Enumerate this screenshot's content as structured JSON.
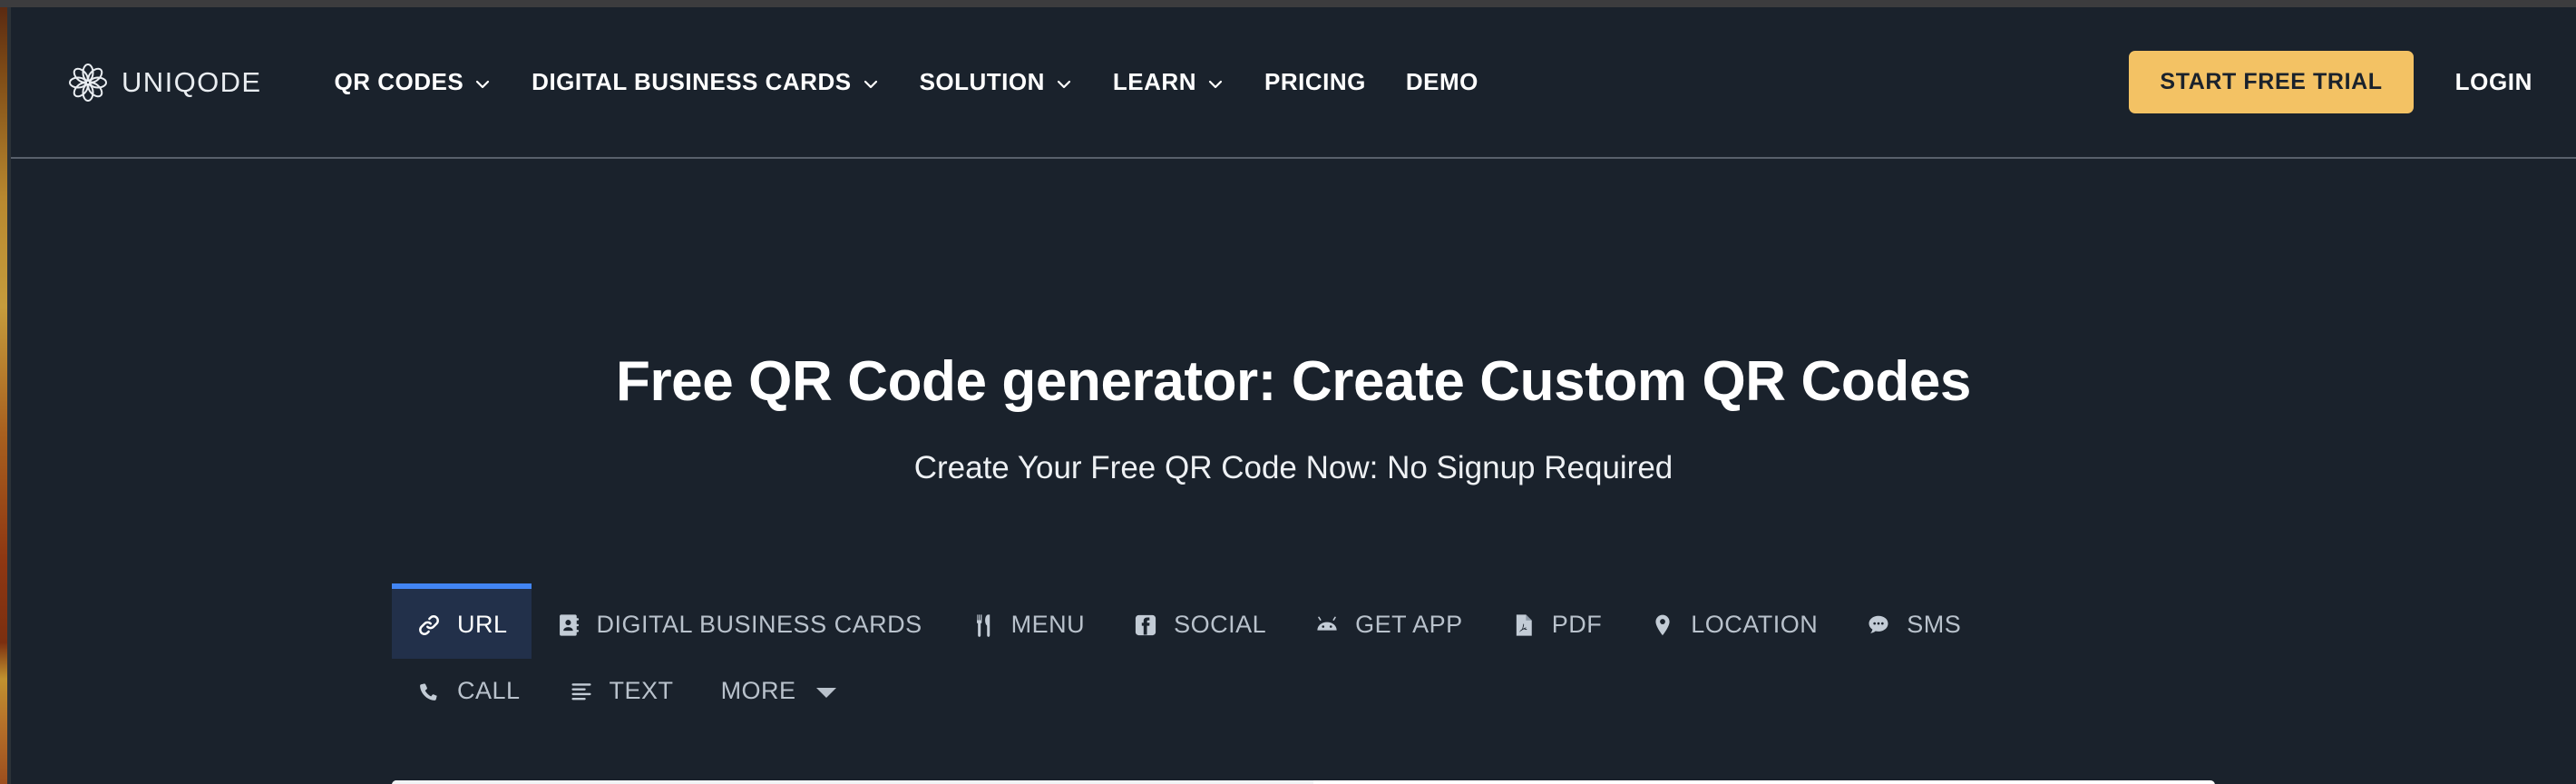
{
  "brand": {
    "name": "UNIQODE",
    "logo_icon": "flower-rosette-logo-icon"
  },
  "nav": {
    "items": [
      {
        "label": "QR CODES",
        "has_dropdown": true
      },
      {
        "label": "DIGITAL BUSINESS CARDS",
        "has_dropdown": true
      },
      {
        "label": "SOLUTION",
        "has_dropdown": true
      },
      {
        "label": "LEARN",
        "has_dropdown": true
      },
      {
        "label": "PRICING",
        "has_dropdown": false
      },
      {
        "label": "DEMO",
        "has_dropdown": false
      }
    ]
  },
  "header_actions": {
    "cta_label": "START FREE TRIAL",
    "login_label": "LOGIN"
  },
  "hero": {
    "title": "Free QR Code generator: Create Custom QR Codes",
    "subtitle": "Create Your Free QR Code Now: No Signup Required"
  },
  "tabs": {
    "active": "URL",
    "row1": [
      {
        "label": "URL",
        "icon": "link-icon",
        "active": true
      },
      {
        "label": "DIGITAL BUSINESS CARDS",
        "icon": "contact-card-icon",
        "active": false
      },
      {
        "label": "MENU",
        "icon": "fork-knife-icon",
        "active": false
      },
      {
        "label": "SOCIAL",
        "icon": "facebook-icon",
        "active": false
      },
      {
        "label": "GET APP",
        "icon": "android-icon",
        "active": false
      },
      {
        "label": "PDF",
        "icon": "pdf-file-icon",
        "active": false
      },
      {
        "label": "LOCATION",
        "icon": "map-pin-icon",
        "active": false
      },
      {
        "label": "SMS",
        "icon": "chat-bubble-icon",
        "active": false
      }
    ],
    "row2": [
      {
        "label": "CALL",
        "icon": "phone-icon",
        "active": false
      },
      {
        "label": "TEXT",
        "icon": "text-lines-icon",
        "active": false
      },
      {
        "label": "MORE",
        "icon": "caret-down-icon",
        "active": false
      }
    ]
  },
  "colors": {
    "page_background": "#1a222c",
    "header_border": "#58606b",
    "cta_yellow": "#f3c264",
    "active_tab_underline": "#4285f4",
    "active_tab_background": "#22304a",
    "tab_text": "#b9c2cc",
    "panel_white": "#ffffff"
  }
}
